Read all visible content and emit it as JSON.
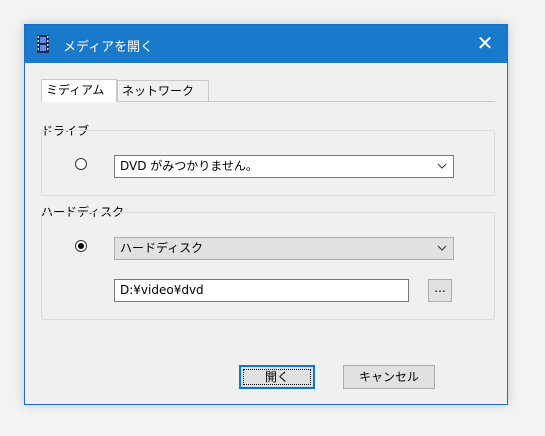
{
  "window": {
    "title": "メディアを開く",
    "close_symbol": "✕"
  },
  "tabs": [
    {
      "label": "ミディアム",
      "active": true
    },
    {
      "label": "ネットワーク",
      "active": false
    }
  ],
  "drive_group": {
    "label": "ドライブ",
    "selected": false,
    "dropdown_value": "DVD がみつかりません。"
  },
  "disk_group": {
    "label": "ハードディスク",
    "selected": true,
    "dropdown_value": "ハードディスク",
    "path_value": "D:¥video¥dvd",
    "browse_label": "..."
  },
  "buttons": {
    "open_label": "開く",
    "cancel_label": "キャンセル"
  },
  "colors": {
    "titlebar": "#1979ca",
    "window_border": "#1b6fc8",
    "dialog_bg": "#f0f0f0"
  }
}
